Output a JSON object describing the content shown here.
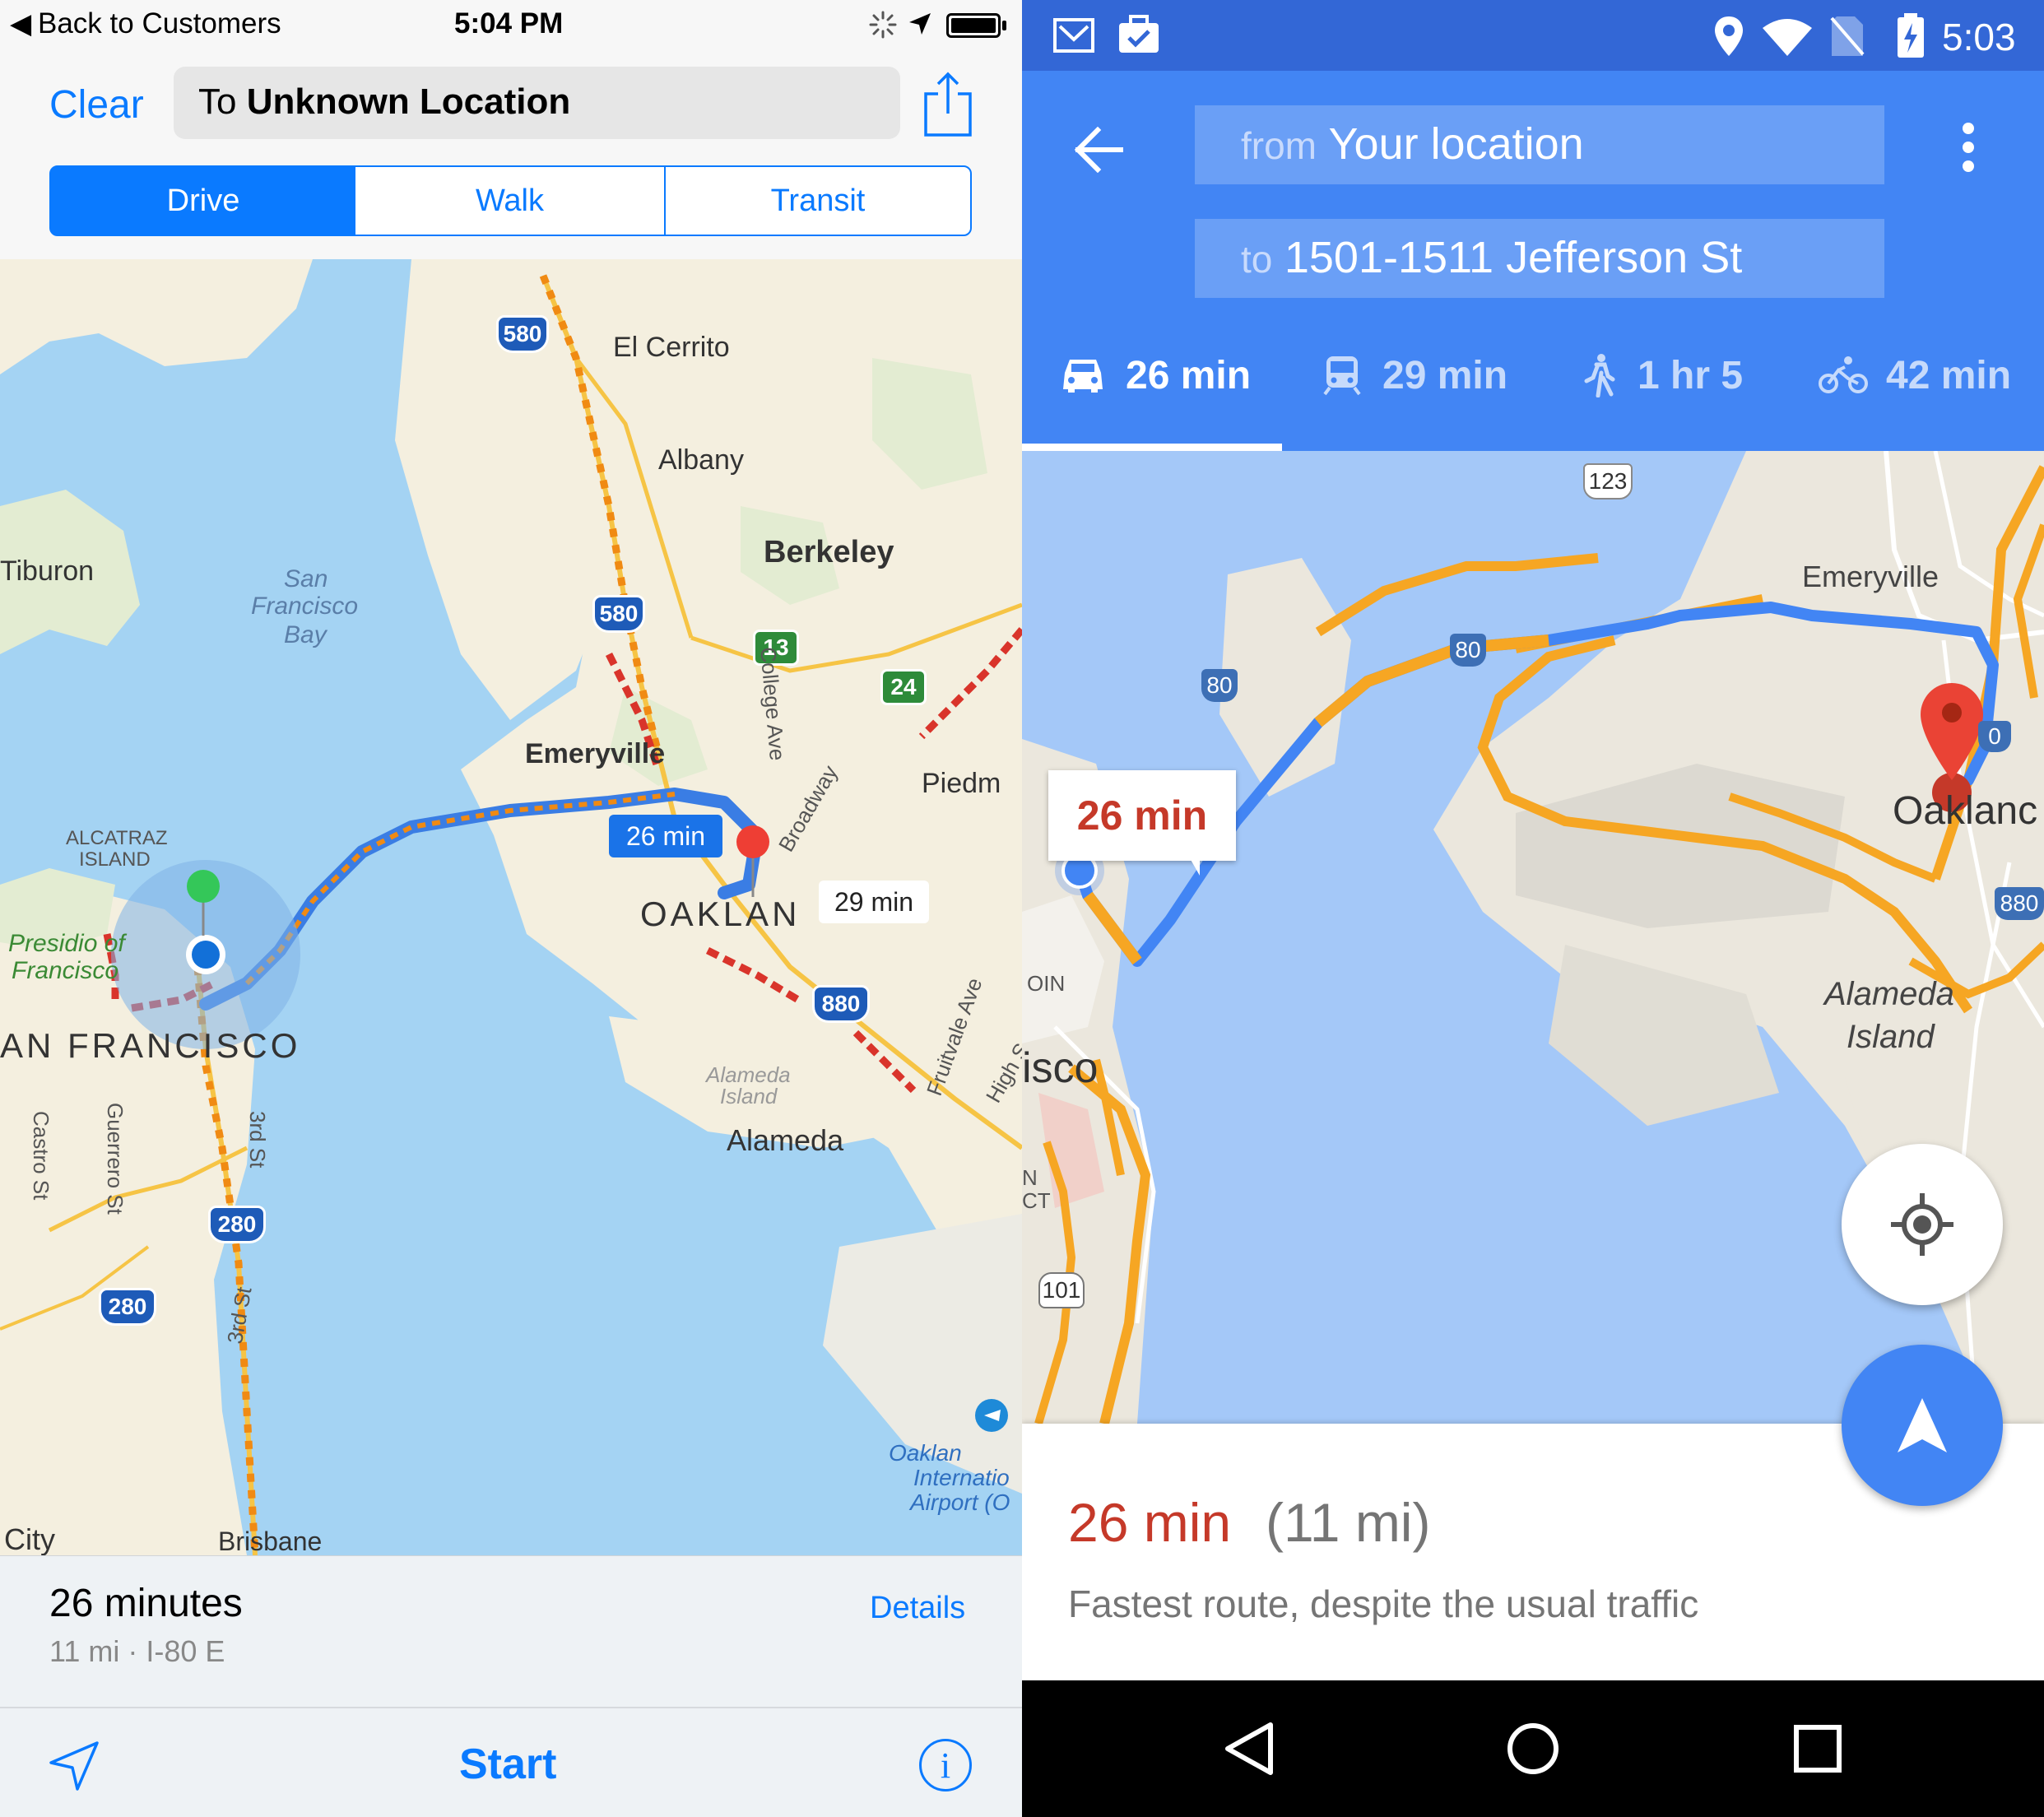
{
  "ios": {
    "status": {
      "back": "Back to Customers",
      "time": "5:04 PM"
    },
    "header": {
      "clear": "Clear",
      "to_prefix": "To",
      "destination": "Unknown Location"
    },
    "modes": [
      "Drive",
      "Walk",
      "Transit"
    ],
    "map": {
      "labels": {
        "el_cerrito": "El Cerrito",
        "albany": "Albany",
        "berkeley": "Berkeley",
        "tiburon": "Tiburon",
        "sf_bay_1": "San",
        "sf_bay_2": "Francisco",
        "sf_bay_3": "Bay",
        "emeryville": "Emeryville",
        "piedmont": "Piedm",
        "alcatraz_1": "ALCATRAZ",
        "alcatraz_2": "ISLAND",
        "presidio_1": "Presidio of",
        "presidio_2": "Francisco",
        "san_francisco": "AN FRANCISCO",
        "oakland": "OAKLAN",
        "alameda_island_1": "Alameda",
        "alameda_island_2": "Island",
        "alameda": "Alameda",
        "college_ave": "College Ave",
        "broadway": "Broadway",
        "fruitvale": "Fruitvale Ave",
        "high": "High S",
        "castro": "Castro St",
        "guerrero": "Guerrero St",
        "third_st_1": "3rd St",
        "third_st_2": "3rd St",
        "oak_airport_1": "Oaklan",
        "oak_airport_2": "Internatio",
        "oak_airport_3": "Airport (O",
        "city": "City",
        "brisbane": "Brisbane"
      },
      "shields": {
        "i580a": "580",
        "i580b": "580",
        "ca13": "13",
        "ca24": "24",
        "i880": "880",
        "i280a": "280",
        "i280b": "280"
      },
      "callout_main": "26 min",
      "callout_alt": "29 min"
    },
    "summary": {
      "duration": "26 minutes",
      "detail": "11 mi · I-80 E",
      "details_link": "Details"
    },
    "toolbar": {
      "start": "Start"
    },
    "colors": {
      "accent": "#0a7aff",
      "route": "#3a7de4",
      "traffic_slow": "#f08a13",
      "traffic_heavy": "#d9342b"
    }
  },
  "android": {
    "status": {
      "time": "5:03"
    },
    "from_prefix": "from",
    "from_value": "Your location",
    "to_prefix": "to",
    "to_value": "1501-1511 Jefferson St",
    "modes": [
      {
        "icon": "car-icon",
        "label": "26 min"
      },
      {
        "icon": "train-icon",
        "label": "29 min"
      },
      {
        "icon": "walk-icon",
        "label": "1 hr 5"
      },
      {
        "icon": "bike-icon",
        "label": "42 min"
      }
    ],
    "map": {
      "labels": {
        "emeryville": "Emeryville",
        "oakland": "Oaklanc",
        "alameda_1": "Alameda",
        "alameda_2": "Island",
        "sf": "isco",
        "oin": "OIN",
        "n": "N",
        "ct": "CT"
      },
      "shields": {
        "ca123": "123",
        "i80a": "80",
        "i80b": "80",
        "i880": "880",
        "i880_partial": "0",
        "us101": "101"
      },
      "callout": "26 min"
    },
    "summary": {
      "duration": "26 min",
      "distance": "(11 mi)",
      "note": "Fastest route, despite the usual traffic"
    },
    "colors": {
      "primary": "#4285f4",
      "status": "#3367d6",
      "duration_red": "#c53929"
    }
  }
}
